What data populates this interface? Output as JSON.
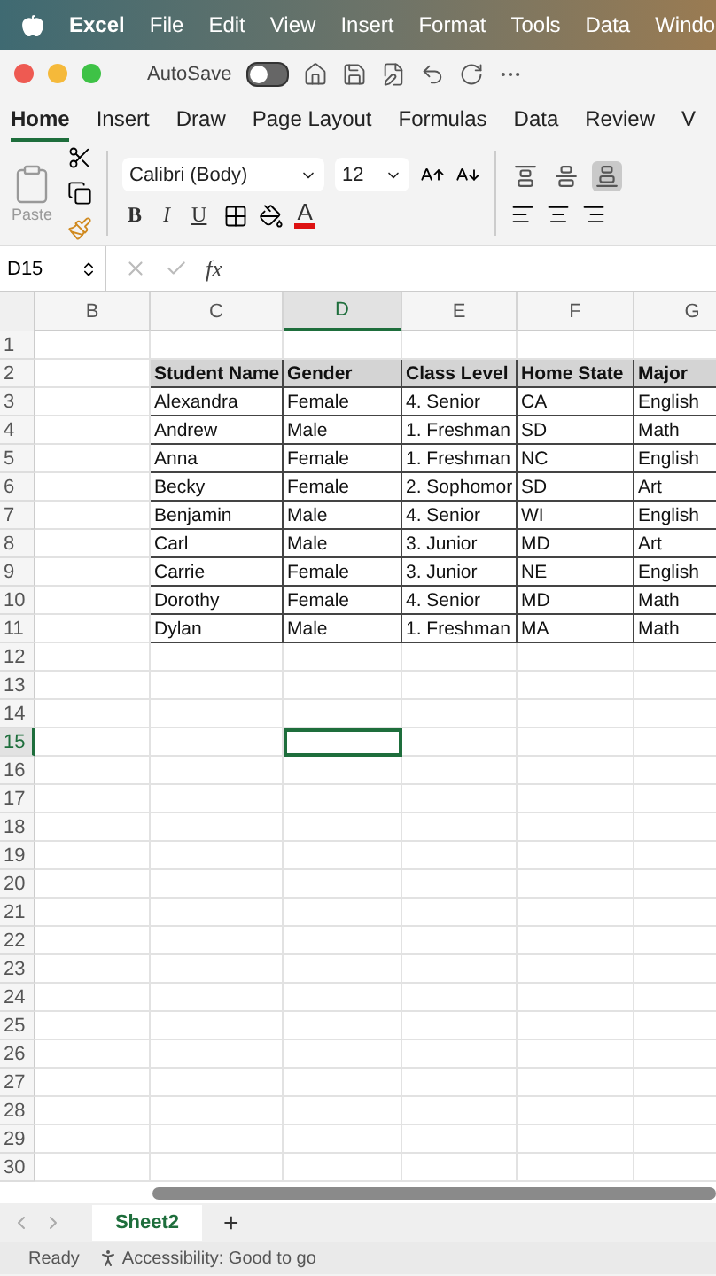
{
  "menu_bar": {
    "app": "Excel",
    "items": [
      "File",
      "Edit",
      "View",
      "Insert",
      "Format",
      "Tools",
      "Data",
      "Windo"
    ]
  },
  "title_bar": {
    "autosave_label": "AutoSave",
    "autosave_on": false
  },
  "tabs": [
    {
      "label": "Home",
      "selected": true
    },
    {
      "label": "Insert",
      "selected": false
    },
    {
      "label": "Draw",
      "selected": false
    },
    {
      "label": "Page Layout",
      "selected": false
    },
    {
      "label": "Formulas",
      "selected": false
    },
    {
      "label": "Data",
      "selected": false
    },
    {
      "label": "Review",
      "selected": false
    },
    {
      "label": "V",
      "selected": false
    }
  ],
  "ribbon": {
    "paste_label": "Paste",
    "font_name": "Calibri (Body)",
    "font_size": "12",
    "bold": "B",
    "italic": "I",
    "underline": "U",
    "font_color": "A",
    "vertical_align": [
      {
        "selected": false
      },
      {
        "selected": false
      },
      {
        "selected": true
      }
    ]
  },
  "formula_bar": {
    "name_box": "D15",
    "fx": "fx"
  },
  "grid": {
    "columns": [
      {
        "label": "B",
        "selected": false
      },
      {
        "label": "C",
        "selected": false
      },
      {
        "label": "D",
        "selected": true
      },
      {
        "label": "E",
        "selected": false
      },
      {
        "label": "F",
        "selected": false
      },
      {
        "label": "G",
        "selected": false
      }
    ],
    "row_numbers": [
      {
        "label": "1",
        "selected": false
      },
      {
        "label": "2",
        "selected": false
      },
      {
        "label": "3",
        "selected": false
      },
      {
        "label": "4",
        "selected": false
      },
      {
        "label": "5",
        "selected": false
      },
      {
        "label": "6",
        "selected": false
      },
      {
        "label": "7",
        "selected": false
      },
      {
        "label": "8",
        "selected": false
      },
      {
        "label": "9",
        "selected": false
      },
      {
        "label": "10",
        "selected": false
      },
      {
        "label": "11",
        "selected": false
      },
      {
        "label": "12",
        "selected": false
      },
      {
        "label": "13",
        "selected": false
      },
      {
        "label": "14",
        "selected": false
      },
      {
        "label": "15",
        "selected": true
      },
      {
        "label": "16",
        "selected": false
      },
      {
        "label": "17",
        "selected": false
      },
      {
        "label": "18",
        "selected": false
      },
      {
        "label": "19",
        "selected": false
      },
      {
        "label": "20",
        "selected": false
      },
      {
        "label": "21",
        "selected": false
      },
      {
        "label": "22",
        "selected": false
      },
      {
        "label": "23",
        "selected": false
      },
      {
        "label": "24",
        "selected": false
      },
      {
        "label": "25",
        "selected": false
      },
      {
        "label": "26",
        "selected": false
      },
      {
        "label": "27",
        "selected": false
      },
      {
        "label": "28",
        "selected": false
      },
      {
        "label": "29",
        "selected": false
      },
      {
        "label": "30",
        "selected": false
      }
    ],
    "table": {
      "header": [
        "Student Name",
        "Gender",
        "Class Level",
        "Home State",
        "Major"
      ],
      "rows": [
        [
          "Alexandra",
          "Female",
          "4. Senior",
          "CA",
          "English"
        ],
        [
          "Andrew",
          "Male",
          "1. Freshman",
          "SD",
          "Math"
        ],
        [
          "Anna",
          "Female",
          "1. Freshman",
          "NC",
          "English"
        ],
        [
          "Becky",
          "Female",
          "2. Sophomor",
          "SD",
          "Art"
        ],
        [
          "Benjamin",
          "Male",
          "4. Senior",
          "WI",
          "English"
        ],
        [
          "Carl",
          "Male",
          "3. Junior",
          "MD",
          "Art"
        ],
        [
          "Carrie",
          "Female",
          "3. Junior",
          "NE",
          "English"
        ],
        [
          "Dorothy",
          "Female",
          "4. Senior",
          "MD",
          "Math"
        ],
        [
          "Dylan",
          "Male",
          "1. Freshman",
          "MA",
          "Math"
        ]
      ]
    }
  },
  "sheet_tabs": [
    {
      "label": "Sheet2",
      "selected": true
    }
  ],
  "add_sheet": "+",
  "status_bar": {
    "state": "Ready",
    "accessibility": "Accessibility: Good to go"
  }
}
